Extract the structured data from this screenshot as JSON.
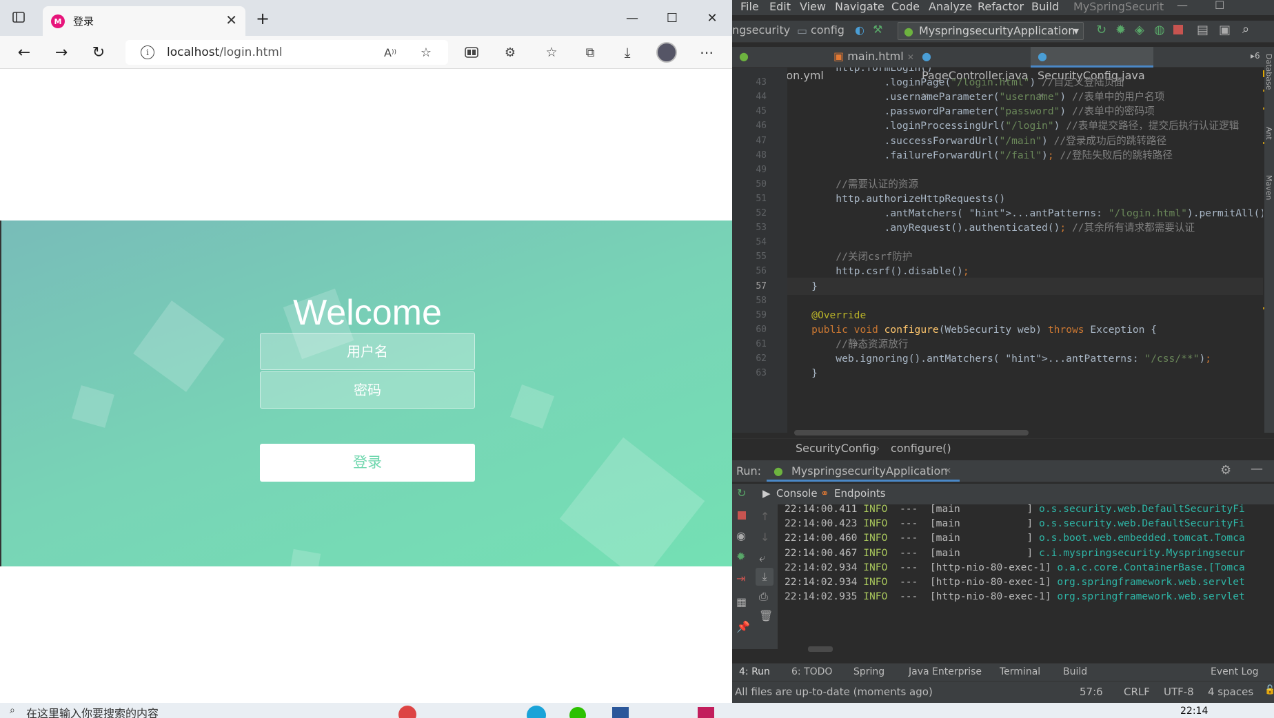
{
  "browser": {
    "tab_title": "登录",
    "tab_favicon_glyph": "M",
    "url_host": "localhost",
    "url_path": "/login.html",
    "page": {
      "welcome": "Welcome",
      "username_placeholder": "用户名",
      "password_placeholder": "密码",
      "login_button": "登录"
    }
  },
  "taskbar": {
    "search_placeholder": "在这里输入你要搜索的内容",
    "clock": "22:14"
  },
  "ide": {
    "menu": [
      "File",
      "Edit",
      "View",
      "Navigate",
      "Code",
      "Analyze",
      "Refactor",
      "Build"
    ],
    "project_title": "MySpringSecurit",
    "toolbar": {
      "crumb_project": "ngsecurity",
      "crumb_folder": "config",
      "run_config": "MyspringsecurityApplication"
    },
    "tabs": [
      "application.yml",
      "main.html",
      "PageController.java",
      "SecurityConfig.java"
    ],
    "tabs_overflow": "6",
    "code": [
      {
        "n": "",
        "text": "        http.formLogin()"
      },
      {
        "n": "43",
        "text": "                .loginPage(\"/login.html\") //自定义登陆页面"
      },
      {
        "n": "44",
        "text": "                .usernameParameter(\"username\") //表单中的用户名项"
      },
      {
        "n": "45",
        "text": "                .passwordParameter(\"password\") //表单中的密码项"
      },
      {
        "n": "46",
        "text": "                .loginProcessingUrl(\"/login\") //表单提交路径，提交后执行认证逻辑"
      },
      {
        "n": "47",
        "text": "                .successForwardUrl(\"/main\") //登录成功后的跳转路径"
      },
      {
        "n": "48",
        "text": "                .failureForwardUrl(\"/fail\"); //登陆失败后的跳转路径"
      },
      {
        "n": "49",
        "text": ""
      },
      {
        "n": "50",
        "text": "        //需要认证的资源"
      },
      {
        "n": "51",
        "text": "        http.authorizeHttpRequests()"
      },
      {
        "n": "52",
        "text": "                .antMatchers( ...antPatterns: \"/login.html\").permitAll() //登录页"
      },
      {
        "n": "53",
        "text": "                .anyRequest().authenticated(); //其余所有请求都需要认证"
      },
      {
        "n": "54",
        "text": ""
      },
      {
        "n": "55",
        "text": "        //关闭csrf防护"
      },
      {
        "n": "56",
        "text": "        http.csrf().disable();"
      },
      {
        "n": "57",
        "text": "    }"
      },
      {
        "n": "58",
        "text": ""
      },
      {
        "n": "59",
        "text": "    @Override"
      },
      {
        "n": "60",
        "text": "    public void configure(WebSecurity web) throws Exception {"
      },
      {
        "n": "61",
        "text": "        //静态资源放行"
      },
      {
        "n": "62",
        "text": "        web.ignoring().antMatchers( ...antPatterns: \"/css/**\");"
      },
      {
        "n": "63",
        "text": "    }"
      }
    ],
    "breadcrumb": [
      "SecurityConfig",
      "configure()"
    ],
    "run": {
      "label": "Run:",
      "app": "MyspringsecurityApplication",
      "subtabs": [
        "Console",
        "Endpoints"
      ],
      "logs": [
        {
          "time": "22:14:00.411",
          "level": "INFO",
          "sep": "---",
          "thread": "[main           ]",
          "logger": "o.s.security.web.DefaultSecurityFi"
        },
        {
          "time": "22:14:00.423",
          "level": "INFO",
          "sep": "---",
          "thread": "[main           ]",
          "logger": "o.s.security.web.DefaultSecurityFi"
        },
        {
          "time": "22:14:00.460",
          "level": "INFO",
          "sep": "---",
          "thread": "[main           ]",
          "logger": "o.s.boot.web.embedded.tomcat.Tomca"
        },
        {
          "time": "22:14:00.467",
          "level": "INFO",
          "sep": "---",
          "thread": "[main           ]",
          "logger": "c.i.myspringsecurity.Myspringsecur"
        },
        {
          "time": "22:14:02.934",
          "level": "INFO",
          "sep": "---",
          "thread": "[http-nio-80-exec-1]",
          "logger": "o.a.c.core.ContainerBase.[Tomca"
        },
        {
          "time": "22:14:02.934",
          "level": "INFO",
          "sep": "---",
          "thread": "[http-nio-80-exec-1]",
          "logger": "org.springframework.web.servlet"
        },
        {
          "time": "22:14:02.935",
          "level": "INFO",
          "sep": "---",
          "thread": "[http-nio-80-exec-1]",
          "logger": "org.springframework.web.servlet"
        }
      ]
    },
    "bottom_tabs": [
      "4: Run",
      "6: TODO",
      "Spring",
      "Java Enterprise",
      "Terminal",
      "Build",
      "Event Log"
    ],
    "status": {
      "message": "All files are up-to-date (moments ago)",
      "position": "57:6",
      "line_sep": "CRLF",
      "encoding": "UTF-8",
      "indent": "4 spaces"
    },
    "side_labels": [
      "Database",
      "Ant",
      "Maven"
    ]
  }
}
